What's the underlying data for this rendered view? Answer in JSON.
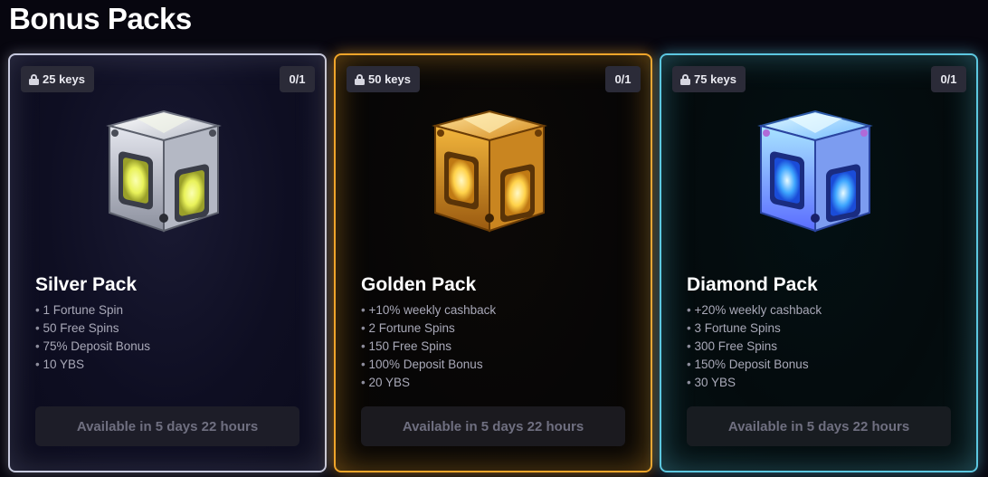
{
  "page": {
    "title": "Bonus Packs"
  },
  "packs": [
    {
      "id": "silver",
      "keys_label": "25 keys",
      "count_label": "0/1",
      "name": "Silver Pack",
      "perks": [
        "1 Fortune Spin",
        "50 Free Spins",
        "75% Deposit Bonus",
        "10 YBS"
      ],
      "button_label": "Available in 5 days 22 hours",
      "accent_color": "#c7cadf",
      "icon": "silver-cube-icon"
    },
    {
      "id": "golden",
      "keys_label": "50 keys",
      "count_label": "0/1",
      "name": "Golden Pack",
      "perks": [
        "+10% weekly cashback",
        "2 Fortune Spins",
        "150 Free Spins",
        "100% Deposit Bonus",
        "20 YBS"
      ],
      "button_label": "Available in 5 days 22 hours",
      "accent_color": "#f0a52a",
      "icon": "golden-cube-icon"
    },
    {
      "id": "diamond",
      "keys_label": "75 keys",
      "count_label": "0/1",
      "name": "Diamond Pack",
      "perks": [
        "+20% weekly cashback",
        "3 Fortune Spins",
        "300 Free Spins",
        "150% Deposit Bonus",
        "30 YBS"
      ],
      "button_label": "Available in 5 days 22 hours",
      "accent_color": "#5cc7e0",
      "icon": "diamond-cube-icon"
    }
  ]
}
